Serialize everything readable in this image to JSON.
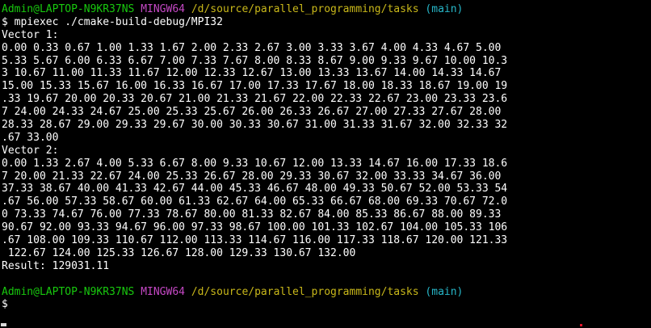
{
  "prompt_first": {
    "user_host": "Admin@LAPTOP-N9KR37NS",
    "shell": "MINGW64",
    "path": "/d/source/parallel_programming/tasks",
    "branch": "(main)"
  },
  "command": "$ mpiexec ./cmake-build-debug/MPI32",
  "output_lines": [
    "Vector 1:",
    "0.00 0.33 0.67 1.00 1.33 1.67 2.00 2.33 2.67 3.00 3.33 3.67 4.00 4.33 4.67 5.00",
    "5.33 5.67 6.00 6.33 6.67 7.00 7.33 7.67 8.00 8.33 8.67 9.00 9.33 9.67 10.00 10.3",
    "3 10.67 11.00 11.33 11.67 12.00 12.33 12.67 13.00 13.33 13.67 14.00 14.33 14.67",
    "15.00 15.33 15.67 16.00 16.33 16.67 17.00 17.33 17.67 18.00 18.33 18.67 19.00 19",
    ".33 19.67 20.00 20.33 20.67 21.00 21.33 21.67 22.00 22.33 22.67 23.00 23.33 23.6",
    "7 24.00 24.33 24.67 25.00 25.33 25.67 26.00 26.33 26.67 27.00 27.33 27.67 28.00",
    "28.33 28.67 29.00 29.33 29.67 30.00 30.33 30.67 31.00 31.33 31.67 32.00 32.33 32",
    ".67 33.00",
    "Vector 2:",
    "0.00 1.33 2.67 4.00 5.33 6.67 8.00 9.33 10.67 12.00 13.33 14.67 16.00 17.33 18.6",
    "7 20.00 21.33 22.67 24.00 25.33 26.67 28.00 29.33 30.67 32.00 33.33 34.67 36.00",
    "37.33 38.67 40.00 41.33 42.67 44.00 45.33 46.67 48.00 49.33 50.67 52.00 53.33 54",
    ".67 56.00 57.33 58.67 60.00 61.33 62.67 64.00 65.33 66.67 68.00 69.33 70.67 72.0",
    "0 73.33 74.67 76.00 77.33 78.67 80.00 81.33 82.67 84.00 85.33 86.67 88.00 89.33",
    "90.67 92.00 93.33 94.67 96.00 97.33 98.67 100.00 101.33 102.67 104.00 105.33 106",
    ".67 108.00 109.33 110.67 112.00 113.33 114.67 116.00 117.33 118.67 120.00 121.33",
    " 122.67 124.00 125.33 126.67 128.00 129.33 130.67 132.00",
    "Result: 129031.11"
  ],
  "prompt_second": {
    "user_host": "Admin@LAPTOP-N9KR37NS",
    "shell": "MINGW64",
    "path": "/d/source/parallel_programming/tasks",
    "branch": "(main)"
  },
  "second_prompt_symbol": "$",
  "colors": {
    "background": "#000000",
    "text": "#ffffff",
    "user_host": "#18c90e",
    "shell": "#c548c5",
    "path": "#c9b81a",
    "branch": "#27b7c9"
  }
}
